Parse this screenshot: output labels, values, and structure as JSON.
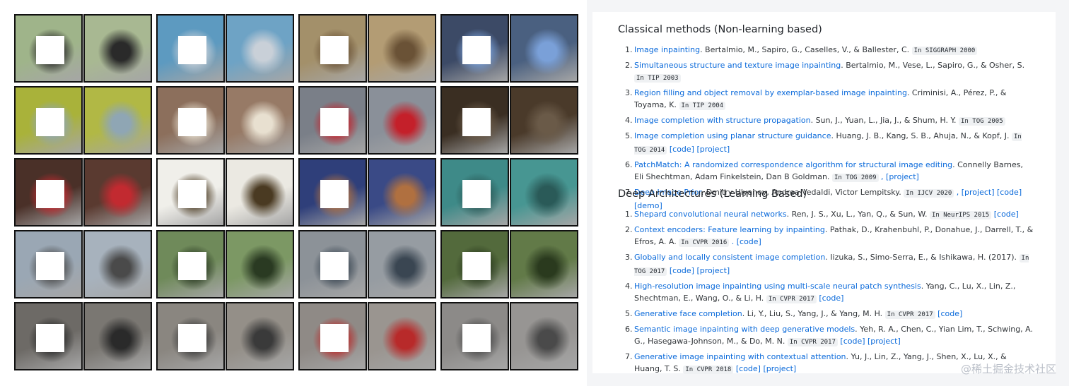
{
  "classical": {
    "heading": "Classical methods (Non-learning based)",
    "items": [
      {
        "num": "1.",
        "title": "Image inpainting",
        "rest": ". Bertalmio, M., Sapiro, G., Caselles, V., & Ballester, C. ",
        "venue": "In SIGGRAPH 2000",
        "tail": ""
      },
      {
        "num": "2.",
        "title": "Simultaneous structure and texture image inpainting",
        "rest": ". Bertalmio, M., Vese, L., Sapiro, G., & Osher, S. ",
        "venue": "In TIP 2003",
        "tail": ""
      },
      {
        "num": "3.",
        "title": "Region filling and object removal by exemplar-based image inpainting",
        "rest": ". Criminisi, A., Pérez, P., & Toyama, K. ",
        "venue": "In TIP 2004",
        "tail": ""
      },
      {
        "num": "4.",
        "title": "Image completion with structure propagation",
        "rest": ". Sun, J., Yuan, L., Jia, J., & Shum, H. Y. ",
        "venue": "In TOG 2005",
        "tail": ""
      },
      {
        "num": "5.",
        "title": "Image completion using planar structure guidance",
        "rest": ". Huang, J. B., Kang, S. B., Ahuja, N., & Kopf, J. ",
        "venue": "In TOG 2014",
        "tail": " [code] [project]"
      },
      {
        "num": "6.",
        "title": "PatchMatch: A randomized correspondence algorithm for structural image editing",
        "rest": ". Connelly Barnes, Eli Shechtman, Adam Finkelstein, Dan B Goldman. ",
        "venue": "In TOG 2009",
        "tail": " , [project]"
      },
      {
        "num": "7.",
        "title": "Deep Image Prior",
        "rest": ". Dmitry Ulyanov, Andrea Vedaldi, Victor Lempitsky. ",
        "venue": "In IJCV 2020",
        "tail": " , [project] [code] [demo]"
      }
    ]
  },
  "deep": {
    "heading": "Deep Architectures (Learning Based)",
    "items": [
      {
        "num": "1.",
        "title": "Shepard convolutional neural networks",
        "rest": ". Ren, J. S., Xu, L., Yan, Q., & Sun, W. ",
        "venue": "In NeurIPS 2015",
        "tail": " [code]"
      },
      {
        "num": "2.",
        "title": "Context encoders: Feature learning by inpainting",
        "rest": ". Pathak, D., Krahenbuhl, P., Donahue, J., Darrell, T., & Efros, A. A. ",
        "venue": "In CVPR 2016",
        "tail": " . [code]"
      },
      {
        "num": "3.",
        "title": "Globally and locally consistent image completion",
        "rest": ". Iizuka, S., Simo-Serra, E., & Ishikawa, H. (2017). ",
        "venue": "In TOG 2017",
        "tail": " [code] [project]"
      },
      {
        "num": "4.",
        "title": "High-resolution image inpainting using multi-scale neural patch synthesis",
        "rest": ". Yang, C., Lu, X., Lin, Z., Shechtman, E., Wang, O., & Li, H. ",
        "venue": "In CVPR 2017",
        "tail": " [code]"
      },
      {
        "num": "5.",
        "title": "Generative face completion",
        "rest": ". Li, Y., Liu, S., Yang, J., & Yang, M. H. ",
        "venue": "In CVPR 2017",
        "tail": " [code]"
      },
      {
        "num": "6.",
        "title": "Semantic image inpainting with deep generative models",
        "rest": ". Yeh, R. A., Chen, C., Yian Lim, T., Schwing, A. G., Hasegawa-Johnson, M., & Do, M. N. ",
        "venue": "In CVPR 2017",
        "tail": " [code] [project]"
      },
      {
        "num": "7.",
        "title": "Generative image inpainting with contextual attention",
        "rest": ". Yu, J., Lin, Z., Yang, J., Shen, X., Lu, X., & Huang, T. S. ",
        "venue": "In CVPR 2018",
        "tail": " [code] [project]"
      }
    ]
  },
  "watermark": "@稀土掘金技术社区",
  "grid": {
    "rows": 5,
    "cols": 8,
    "scene_colors": [
      [
        "#9fb48a",
        "#a8b892",
        "#5d9ac0",
        "#6ea3c5",
        "#a3906a",
        "#b39c74",
        "#3c4a66",
        "#4a6080"
      ],
      [
        "#a9b23a",
        "#b1b845",
        "#8c6f5c",
        "#977a66",
        "#7a7f88",
        "#8a9099",
        "#3a2e22",
        "#4a3a2a"
      ],
      [
        "#4a3028",
        "#5a3a30",
        "#f0efea",
        "#ebe9e2",
        "#2f3f7a",
        "#3a4a86",
        "#3e8a88",
        "#479692"
      ],
      [
        "#9aa7b4",
        "#a7b2bd",
        "#6f8a5a",
        "#7c9864",
        "#8c9298",
        "#969ca2",
        "#536a3c",
        "#627a48"
      ],
      [
        "#6d6a66",
        "#7a7772",
        "#8a8680",
        "#948f88",
        "#8f8a86",
        "#9a9590",
        "#8c8a88",
        "#979593"
      ]
    ],
    "accent_colors": [
      [
        "#2a2a2a",
        "#2a2a2a",
        "#c9d0d8",
        "#c9d0d8",
        "#6a5236",
        "#6a5236",
        "#7aa0d8",
        "#7aa0d8"
      ],
      [
        "#8fa6b4",
        "#8fa6b4",
        "#e8e0d0",
        "#e8e0d0",
        "#c4202a",
        "#c4202a",
        "#6a5a48",
        "#6a5a48"
      ],
      [
        "#c22a30",
        "#c22a30",
        "#4a3a22",
        "#4a3a22",
        "#b07040",
        "#b07040",
        "#2a5a58",
        "#2a5a58"
      ],
      [
        "#4a4a4a",
        "#4a4a4a",
        "#2a3a22",
        "#2a3a22",
        "#3a4652",
        "#3a4652",
        "#2a3a1e",
        "#2a3a1e"
      ],
      [
        "#2a2a2a",
        "#2a2a2a",
        "#3a3a3a",
        "#3a3a3a",
        "#b82a2a",
        "#b82a2a",
        "#4a4a4a",
        "#4a4a4a"
      ]
    ]
  }
}
